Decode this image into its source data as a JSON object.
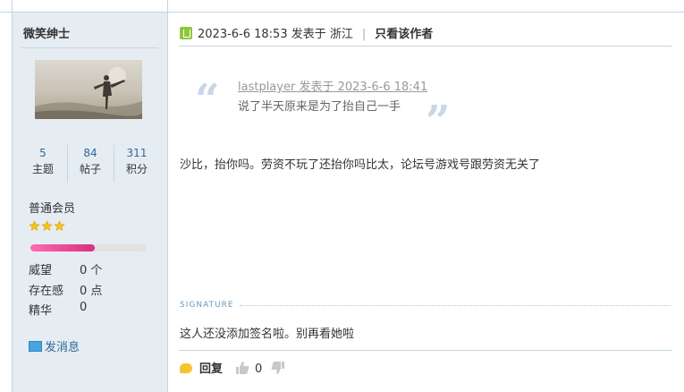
{
  "user": {
    "name": "微笑绅士",
    "stats": [
      {
        "value": "5",
        "label": "主题"
      },
      {
        "value": "84",
        "label": "帖子"
      },
      {
        "value": "311",
        "label": "积分"
      }
    ],
    "rank": "普通会员",
    "star_count": 3,
    "level_progress": 0.55,
    "meta": [
      {
        "label": "威望",
        "value": "0 个"
      },
      {
        "label": "存在感",
        "value": "0 点"
      },
      {
        "label": "精华",
        "value": "0"
      }
    ],
    "pm_label": "发消息"
  },
  "post": {
    "header": {
      "posted": "2023-6-6 18:53 发表于 浙江",
      "sep": "|",
      "only_author": "只看该作者"
    },
    "quote": {
      "who": "lastplayer 发表于 2023-6-6 18:41",
      "text": "说了半天原来是为了抬自己一手"
    },
    "body": "沙比，抬你吗。劳资不玩了还抬你吗比太，论坛号游戏号跟劳资无关了",
    "signature_label": "SIGNATURE",
    "signature": "这人还没添加签名啦。别再看她啦",
    "footer": {
      "reply_label": "回复",
      "support_count": "0"
    }
  },
  "colors": {
    "sidebar_bg": "#e5edf2",
    "border": "#c2d5e3",
    "link": "#336699",
    "progress": "#e0458f",
    "online": "#8ec63f"
  }
}
